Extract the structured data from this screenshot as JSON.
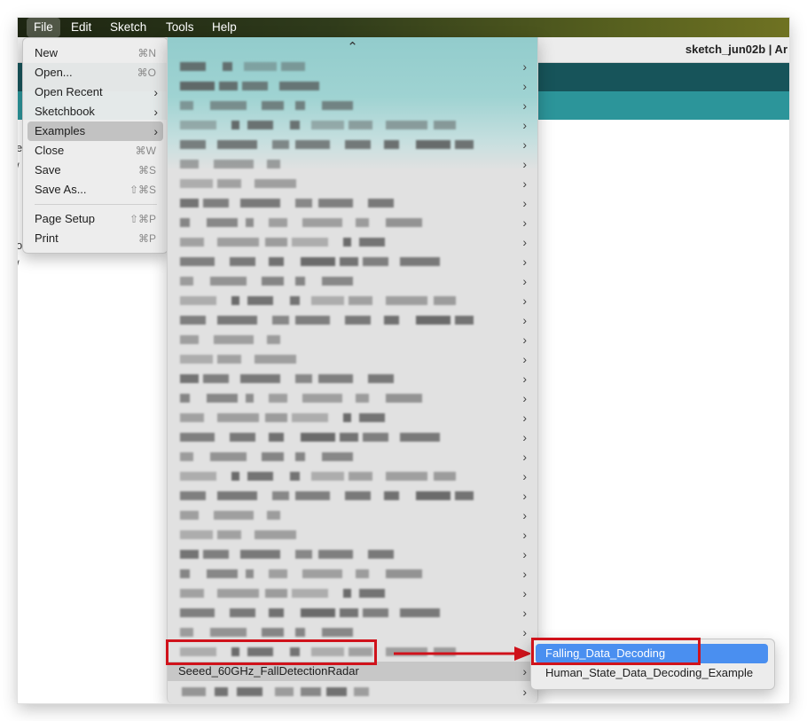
{
  "menubar": {
    "items": [
      {
        "label": "File",
        "active": true
      },
      {
        "label": "Edit"
      },
      {
        "label": "Sketch"
      },
      {
        "label": "Tools"
      },
      {
        "label": "Help"
      }
    ]
  },
  "window": {
    "title": "sketch_jun02b | Ar"
  },
  "file_menu": {
    "items": [
      {
        "label": "New",
        "shortcut": "⌘N"
      },
      {
        "label": "Open...",
        "shortcut": "⌘O"
      },
      {
        "label": "Open Recent",
        "submenu": true
      },
      {
        "label": "Sketchbook",
        "submenu": true
      },
      {
        "label": "Examples",
        "submenu": true,
        "active": true
      },
      {
        "label": "Close",
        "shortcut": "⌘W"
      },
      {
        "label": "Save",
        "shortcut": "⌘S"
      },
      {
        "label": "Save As...",
        "shortcut": "⇧⌘S"
      },
      {
        "label": "Page Setup",
        "shortcut": "⇧⌘P"
      },
      {
        "label": "Print",
        "shortcut": "⌘P"
      }
    ]
  },
  "examples_menu": {
    "scroll_up_glyph": "⌃",
    "highlighted_item": "Seeed_60GHz_FallDetectionRadar"
  },
  "submenu": {
    "items": [
      {
        "label": "Falling_Data_Decoding",
        "selected": true
      },
      {
        "label": "Human_State_Data_Decoding_Example"
      }
    ]
  },
  "colors": {
    "annotation_red": "#d0121b",
    "selection_blue": "#4a8ff0",
    "toolbar_dark_teal": "#17545a",
    "toolbar_teal": "#2c959a"
  },
  "icons": {
    "submenu": "chevron-right-icon",
    "scroll_up": "chevron-up-icon",
    "annotation_arrow": "arrow-right-icon"
  }
}
